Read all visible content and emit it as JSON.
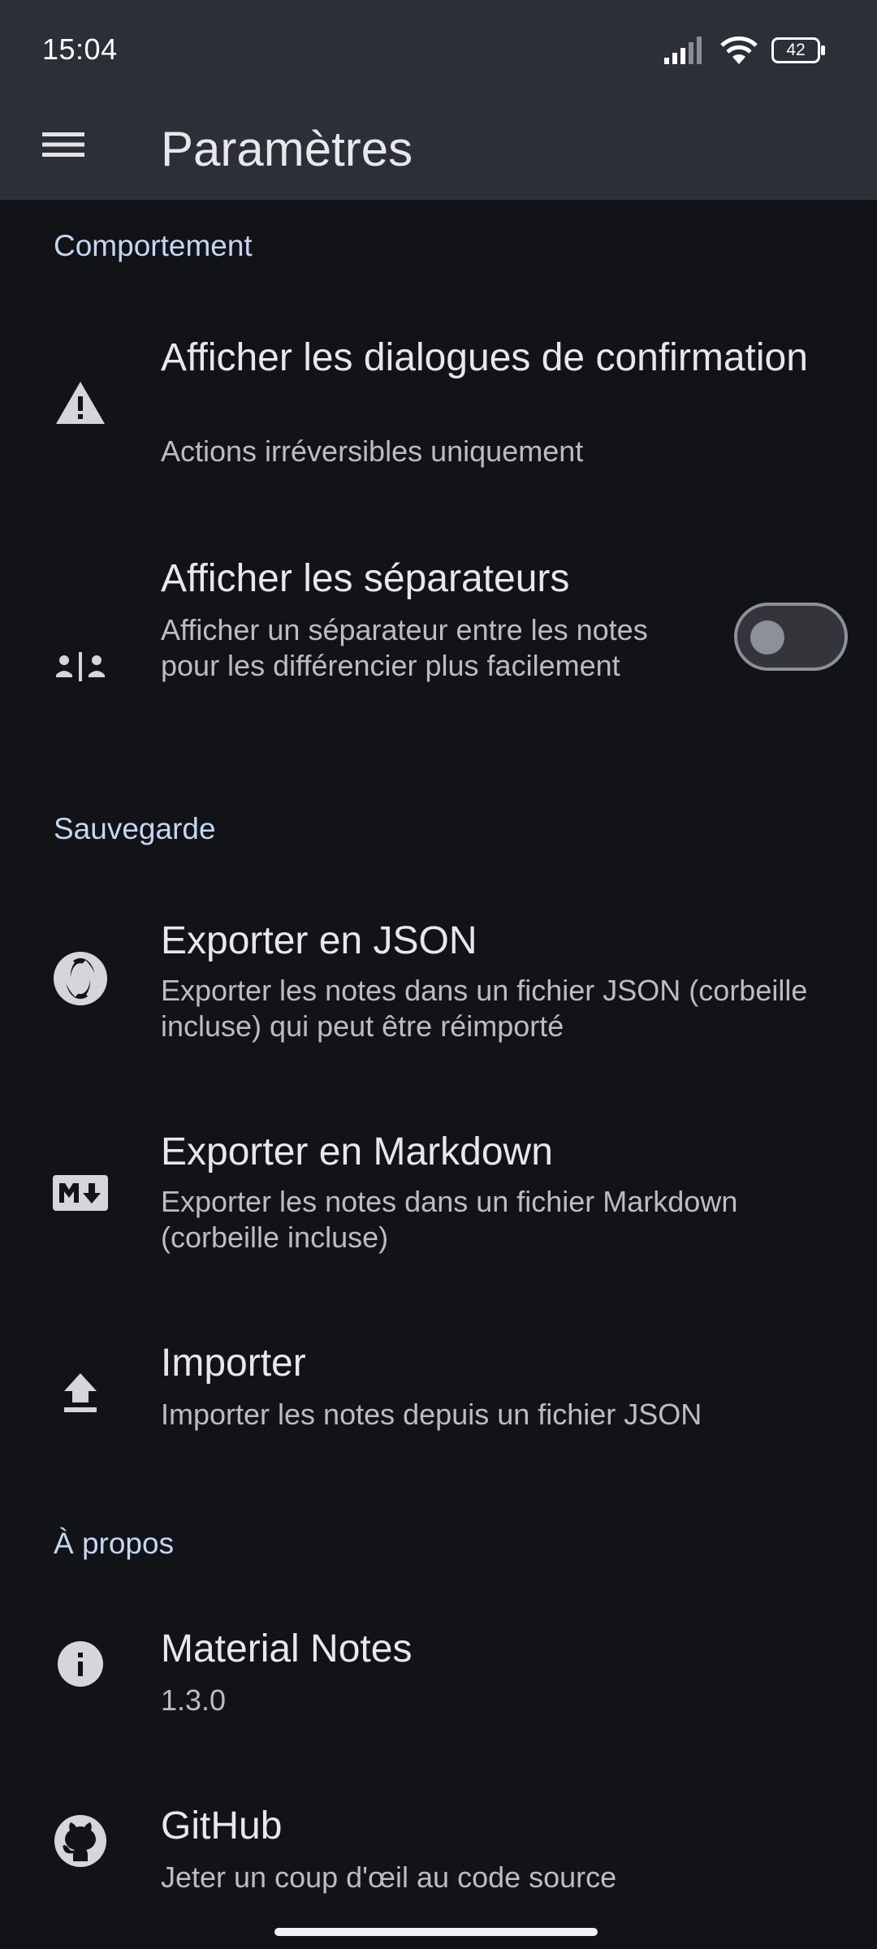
{
  "status": {
    "time": "15:04",
    "battery": "42"
  },
  "app_bar": {
    "title": "Paramètres"
  },
  "sections": {
    "behavior": "Comportement",
    "backup": "Sauvegarde",
    "about": "À propos"
  },
  "prefs": {
    "confirm": {
      "title": "Afficher les dialogues de confirmation",
      "summary": "Actions irréversibles uniquement",
      "icon": "warning-icon"
    },
    "separators": {
      "title": "Afficher les séparateurs",
      "summary": "Afficher un séparateur entre les notes pour les différencier plus facilement",
      "icon": "separator-icon",
      "enabled": false
    },
    "export_json": {
      "title": "Exporter en JSON",
      "summary": "Exporter les notes dans un fichier JSON (corbeille incluse) qui peut être réimporté",
      "icon": "json-icon"
    },
    "export_md": {
      "title": "Exporter en Markdown",
      "summary": "Exporter les notes dans un fichier Markdown (corbeille incluse)",
      "icon": "markdown-icon"
    },
    "import": {
      "title": "Importer",
      "summary": "Importer les notes depuis un fichier JSON",
      "icon": "upload-icon"
    },
    "app_info": {
      "title": "Material Notes",
      "summary": "1.3.0",
      "icon": "info-icon"
    },
    "github": {
      "title": "GitHub",
      "summary": "Jeter un coup d'œil au code source",
      "icon": "github-icon"
    }
  },
  "colors": {
    "background": "#121317",
    "app_bar": "#2c2f37",
    "section_header": "#c4d6f4"
  }
}
